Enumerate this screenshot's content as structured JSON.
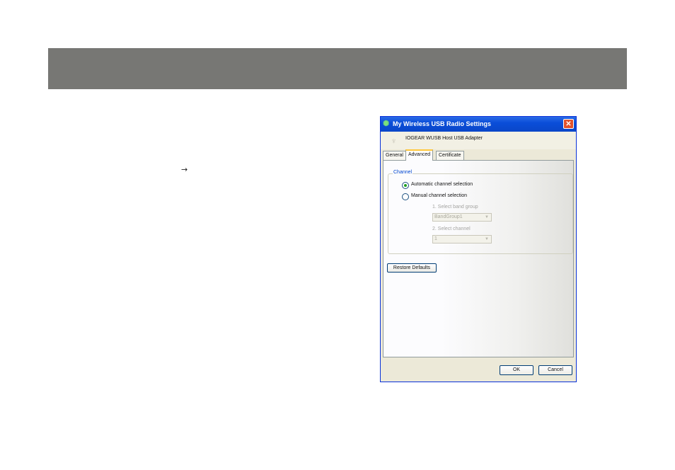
{
  "page": {
    "arrow_glyph": "→"
  },
  "dialog": {
    "title": "My Wireless USB Radio Settings",
    "close_glyph": "✕",
    "device_name": "IOGEAR WUSB Host USB Adapter",
    "tabs": [
      {
        "label": "General",
        "active": false
      },
      {
        "label": "Advanced",
        "active": true
      },
      {
        "label": "Certificate",
        "active": false
      }
    ],
    "channel_group": {
      "label": "Channel",
      "auto_label": "Automatic channel selection",
      "manual_label": "Manual channel selection",
      "selected": "auto",
      "band_group_label": "1. Select band group",
      "band_group_value": "BandGroup1",
      "channel_label": "2. Select channel",
      "channel_value": "1"
    },
    "restore_label": "Restore Defaults",
    "ok_label": "OK",
    "cancel_label": "Cancel"
  },
  "colors": {
    "title_bar": "#0a4ed9",
    "top_band": "#777774",
    "close_button": "#e0522d",
    "radio_selected": "#21a121"
  }
}
